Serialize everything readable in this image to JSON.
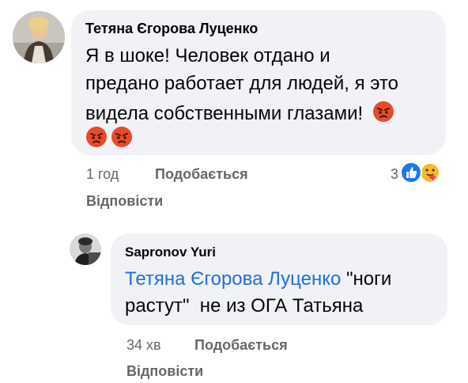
{
  "comment": {
    "author": "Тетяна Єгорова Луценко",
    "text_line1": "Я в шоке! Человек отдано и",
    "text_line2": "предано работает для людей, я это",
    "text_line3": "видела собственными глазами!",
    "emojis": [
      "angry-face",
      "angry-face",
      "angry-face"
    ],
    "time": "1 год",
    "like_label": "Подобається",
    "reply_label": "Відповісти",
    "reaction_count": "3",
    "reactions": [
      "like",
      "care"
    ]
  },
  "reply": {
    "author": "Sapronov Yuri",
    "mention": "Тетяна Єгорова Луценко",
    "text_line1": " \"ноги",
    "text_line2": "растут\"  не из ОГА Татьяна",
    "time": "34 хв",
    "like_label": "Подобається",
    "reply_label": "Відповісти"
  },
  "colors": {
    "bubble": "#f0f2f5",
    "meta": "#65676b",
    "mention": "#216fdb",
    "like_blue": "#1877f2"
  }
}
